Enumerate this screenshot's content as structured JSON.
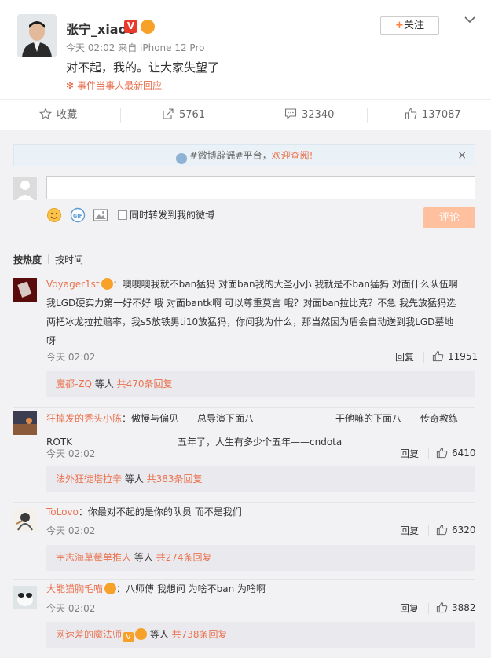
{
  "post": {
    "username": "张宁_xiao8",
    "v_badge": "V",
    "time": "今天 02:02 来自 iPhone 12 Pro",
    "text": "对不起，我的。让大家失望了",
    "event_link": "事件当事人最新回应",
    "follow_label": "关注"
  },
  "actions": {
    "favorite": "收藏",
    "repost": "5761",
    "comment": "32340",
    "like": "137087"
  },
  "notice": {
    "prefix": "#微博辟谣#平台，",
    "highlight": "欢迎查阅!",
    "close": "×"
  },
  "composer": {
    "repost_checkbox_label": "同时转发到我的微博",
    "submit_label": "评论"
  },
  "sort": {
    "hot": "按热度",
    "time": "按时间"
  },
  "comments": [
    {
      "name": "Voyager1st",
      "line1": "：噢噢噢我就不ban猛犸 对面ban我的大圣小小 我就是不ban猛犸 对面什么队伍啊",
      "line2": "我LGD硬实力第一好不好 哦 对面bantk啊 可以尊重莫言 哦？对面ban拉比克？不急 我先放猛犸选",
      "line3": "两把冰龙拉拉赔率，我s5放铁男ti10放猛犸，你问我为什么，那当然因为盾会自动送到我LGD墓地",
      "line4": "呀",
      "time": "今天 02:02",
      "reply": "回复",
      "likes": "11951",
      "sub_name": "魔都-ZQ",
      "sub_mid": " 等人 ",
      "sub_count": "共470条回复"
    },
    {
      "name": "狂掉发的秃头小陈",
      "line1a": "：傲慢与偏见——总导演下面八",
      "line1b": "干他嘛的下面八——传奇教练",
      "line2a": "ROTK",
      "line2b": "五年了，人生有多少个五年——cndota",
      "time": "今天 02:02",
      "reply": "回复",
      "likes": "6410",
      "sub_name": "法外狂徒塔拉辛",
      "sub_mid": " 等人 ",
      "sub_count": "共383条回复"
    },
    {
      "name": "ToLovo",
      "line1": "：你最对不起的是你的队员 而不是我们",
      "time": "今天 02:02",
      "reply": "回复",
      "likes": "6320",
      "sub_name": "宇志海草莓单推人",
      "sub_mid": " 等人 ",
      "sub_count": "共274条回复"
    },
    {
      "name": "大能猫胸毛喵",
      "line1": "：八师傅 我想问 为啥不ban 为啥啊",
      "time": "今天 02:02",
      "reply": "回复",
      "likes": "3882",
      "sub_name": "网速差的魔法师",
      "sub_mid": " 等人 ",
      "sub_count": "共738条回复"
    }
  ]
}
